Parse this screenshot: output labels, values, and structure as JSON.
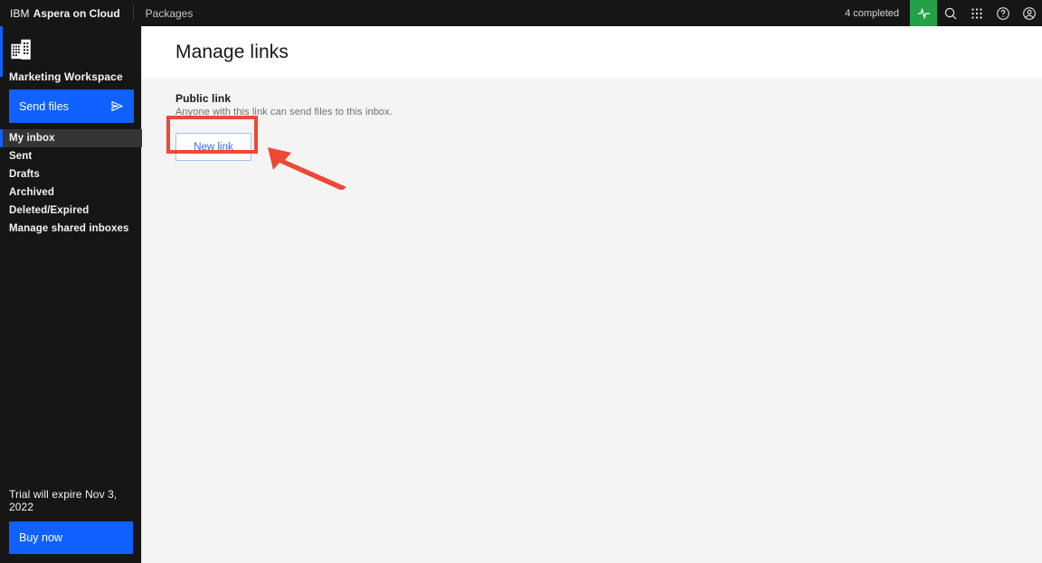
{
  "header": {
    "brand_ibm": "IBM",
    "brand_product": "Aspera on Cloud",
    "packages_label": "Packages",
    "completed_status": "4 completed",
    "icons": {
      "activity": "activity-icon",
      "search": "search-icon",
      "app_switcher": "app-switcher-icon",
      "help": "help-icon",
      "account": "account-icon"
    },
    "accent_color": "#0f62fe",
    "activity_color": "#24a148",
    "background_color": "#161616"
  },
  "sidebar": {
    "workspace_icon": "building-icon",
    "workspace_name": "Marketing Workspace",
    "send_files_label": "Send files",
    "send_files_icon": "send-icon",
    "nav_items": [
      {
        "label": "My inbox",
        "selected": true
      },
      {
        "label": "Sent",
        "selected": false
      },
      {
        "label": "Drafts",
        "selected": false
      },
      {
        "label": "Archived",
        "selected": false
      },
      {
        "label": "Deleted/Expired",
        "selected": false
      },
      {
        "label": "Manage shared inboxes",
        "selected": false
      }
    ],
    "trial_text": "Trial will expire Nov 3, 2022",
    "buy_now_label": "Buy now"
  },
  "main": {
    "page_title": "Manage links",
    "section_title": "Public link",
    "section_subtitle": "Anyone with this link can send files to this inbox.",
    "new_link_label": "New link"
  },
  "annotations": {
    "highlight_color": "#ee4836",
    "highlight_target": "new-link-button",
    "arrow_direction": "up-left"
  }
}
